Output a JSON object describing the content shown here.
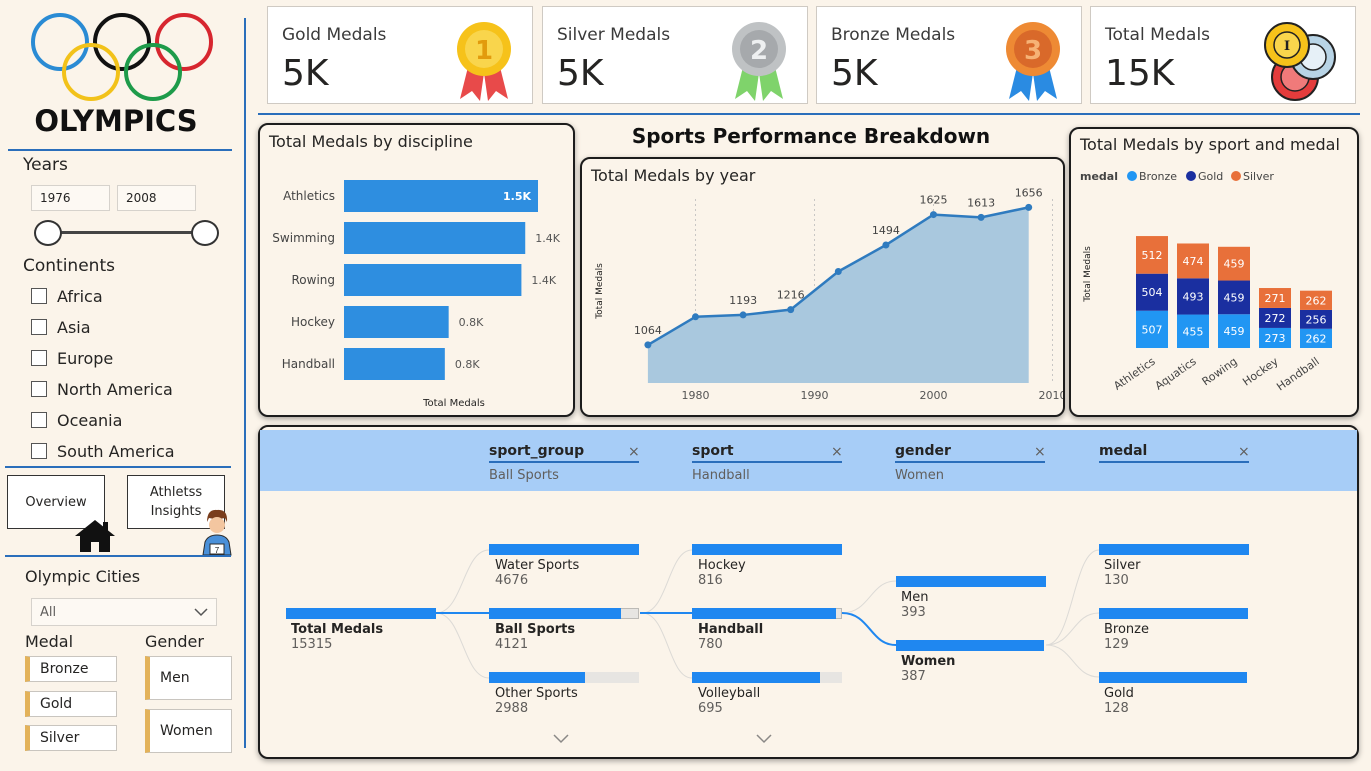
{
  "sidebar": {
    "title": "OLYMPICS",
    "years": {
      "label": "Years",
      "start": "1976",
      "end": "2008"
    },
    "continents": {
      "label": "Continents",
      "items": [
        "Africa",
        "Asia",
        "Europe",
        "North America",
        "Oceania",
        "South America"
      ]
    },
    "nav": {
      "overview": "Overview",
      "athletes_line1": "Athletss",
      "athletes_line2": "Insights"
    },
    "cities": {
      "label": "Olympic Cities",
      "value": "All"
    },
    "medal_filter": {
      "label": "Medal",
      "items": [
        "Bronze",
        "Gold",
        "Silver"
      ]
    },
    "gender_filter": {
      "label": "Gender",
      "items": [
        "Men",
        "Women"
      ]
    }
  },
  "kpis": [
    {
      "label": "Gold Medals",
      "value": "5K",
      "icon": "gold-medal-icon"
    },
    {
      "label": "Silver Medals",
      "value": "5K",
      "icon": "silver-medal-icon"
    },
    {
      "label": "Bronze Medals",
      "value": "5K",
      "icon": "bronze-medal-icon"
    },
    {
      "label": "Total Medals",
      "value": "15K",
      "icon": "medals-stack-icon"
    }
  ],
  "main_title": "Sports Performance Breakdown",
  "chart_data": [
    {
      "type": "bar",
      "title": "Total Medals by discipline",
      "xlabel": "Total Medals",
      "categories": [
        "Athletics",
        "Swimming",
        "Rowing",
        "Hockey",
        "Handball"
      ],
      "values": [
        1520,
        1420,
        1390,
        820,
        790
      ],
      "data_labels": [
        "1.5K",
        "1.4K",
        "1.4K",
        "0.8K",
        "0.8K"
      ],
      "color": "#2e8ee0"
    },
    {
      "type": "area",
      "title": "Total Medals by year",
      "ylabel": "Total Medals",
      "x": [
        1976,
        1980,
        1984,
        1988,
        1992,
        1996,
        2000,
        2004,
        2008
      ],
      "y": [
        1064,
        1185,
        1193,
        1216,
        1380,
        1494,
        1625,
        1613,
        1656
      ],
      "labeled_points": [
        {
          "x": 1976,
          "label": "1064"
        },
        {
          "x": 1984,
          "label": "1193"
        },
        {
          "x": 1988,
          "label": "1216"
        },
        {
          "x": 1996,
          "label": "1494"
        },
        {
          "x": 2000,
          "label": "1625"
        },
        {
          "x": 2004,
          "label": "1613"
        },
        {
          "x": 2008,
          "label": "1656"
        }
      ],
      "xticks": [
        "1980",
        "1990",
        "2000",
        "2010"
      ],
      "xlim": [
        1975,
        2010
      ],
      "ylim": [
        900,
        1720
      ],
      "line_color": "#2f7bbf",
      "fill_color": "#a9c8de"
    },
    {
      "type": "bar",
      "stacked": true,
      "title": "Total Medals by sport and medal",
      "ylabel": "Total Medals",
      "legend_title": "medal",
      "legend_position": "top-left",
      "categories": [
        "Athletics",
        "Aquatics",
        "Rowing",
        "Hockey",
        "Handball"
      ],
      "series": [
        {
          "name": "Bronze",
          "color": "#2196f3",
          "values": [
            507,
            455,
            459,
            273,
            262
          ]
        },
        {
          "name": "Gold",
          "color": "#1a2fa0",
          "values": [
            504,
            493,
            459,
            272,
            256
          ]
        },
        {
          "name": "Silver",
          "color": "#e8703a",
          "values": [
            512,
            474,
            459,
            271,
            262
          ]
        }
      ]
    }
  ],
  "tree": {
    "columns": [
      {
        "title": "sport_group",
        "sub": "Ball Sports"
      },
      {
        "title": "sport",
        "sub": "Handball"
      },
      {
        "title": "gender",
        "sub": "Women"
      },
      {
        "title": "medal",
        "sub": ""
      }
    ],
    "close_glyph": "×",
    "root": {
      "name": "Total Medals",
      "value": "15315"
    },
    "level1": [
      {
        "name": "Water Sports",
        "value": "4676"
      },
      {
        "name": "Ball Sports",
        "value": "4121"
      },
      {
        "name": "Other Sports",
        "value": "2988"
      }
    ],
    "level2": [
      {
        "name": "Hockey",
        "value": "816"
      },
      {
        "name": "Handball",
        "value": "780"
      },
      {
        "name": "Volleyball",
        "value": "695"
      }
    ],
    "level3": [
      {
        "name": "Men",
        "value": "393"
      },
      {
        "name": "Women",
        "value": "387"
      }
    ],
    "level4": [
      {
        "name": "Silver",
        "value": "130"
      },
      {
        "name": "Bronze",
        "value": "129"
      },
      {
        "name": "Gold",
        "value": "128"
      }
    ]
  }
}
